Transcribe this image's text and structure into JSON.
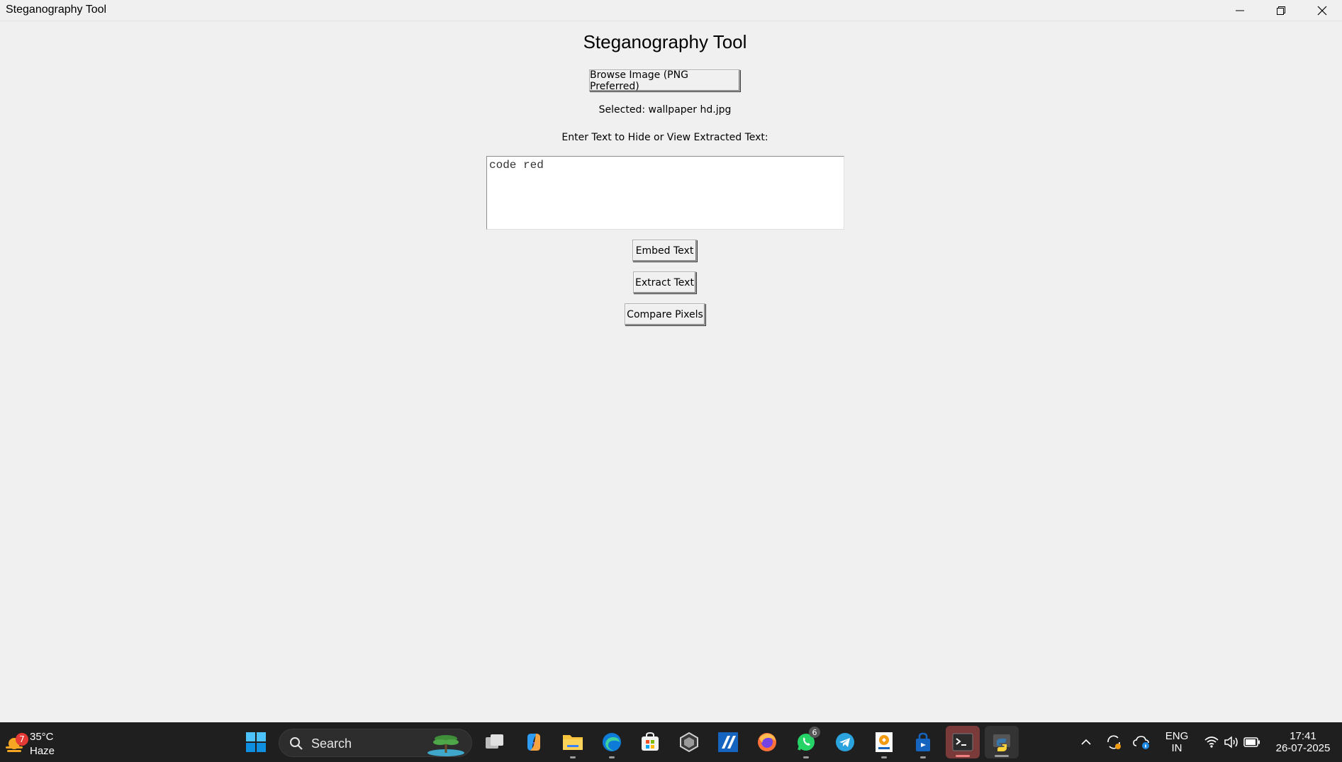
{
  "window": {
    "title": "Steganography Tool",
    "controls": [
      "minimize",
      "maximize",
      "close"
    ]
  },
  "app": {
    "heading": "Steganography Tool",
    "browse_label": "Browse Image (PNG Preferred)",
    "selected_text": "Selected: wallpaper hd.jpg",
    "prompt_text": "Enter Text to Hide or View Extracted Text:",
    "text_value": "code red",
    "embed_label": "Embed Text",
    "extract_label": "Extract Text",
    "compare_label": "Compare Pixels"
  },
  "taskbar": {
    "weather": {
      "temp": "35°C",
      "condition": "Haze",
      "badge": "7",
      "icon": "sun-haze-icon"
    },
    "search_label": "Search",
    "apps": [
      {
        "name": "start-button",
        "icon": "windows-logo-icon"
      },
      {
        "name": "task-view",
        "icon": "task-view-icon"
      },
      {
        "name": "copilot",
        "icon": "copilot-icon"
      },
      {
        "name": "file-explorer",
        "icon": "folder-icon"
      },
      {
        "name": "edge",
        "icon": "edge-icon"
      },
      {
        "name": "store",
        "icon": "store-icon"
      },
      {
        "name": "app-cube",
        "icon": "cube-icon"
      },
      {
        "name": "app-blue",
        "icon": "blue-app-icon"
      },
      {
        "name": "firefox",
        "icon": "firefox-icon"
      },
      {
        "name": "whatsapp",
        "icon": "whatsapp-icon",
        "badge": "6"
      },
      {
        "name": "telegram",
        "icon": "telegram-icon"
      },
      {
        "name": "app-orange",
        "icon": "orange-app-icon"
      },
      {
        "name": "app-bag",
        "icon": "bag-icon"
      },
      {
        "name": "terminal",
        "icon": "terminal-icon"
      },
      {
        "name": "python",
        "icon": "python-icon"
      }
    ],
    "tray": {
      "lang_top": "ENG",
      "lang_bottom": "IN",
      "time": "17:41",
      "date": "26-07-2025"
    }
  },
  "colors": {
    "background": "#f0f0f0",
    "taskbar": "#1f1f1f",
    "accent_blue": "#0078d4"
  }
}
